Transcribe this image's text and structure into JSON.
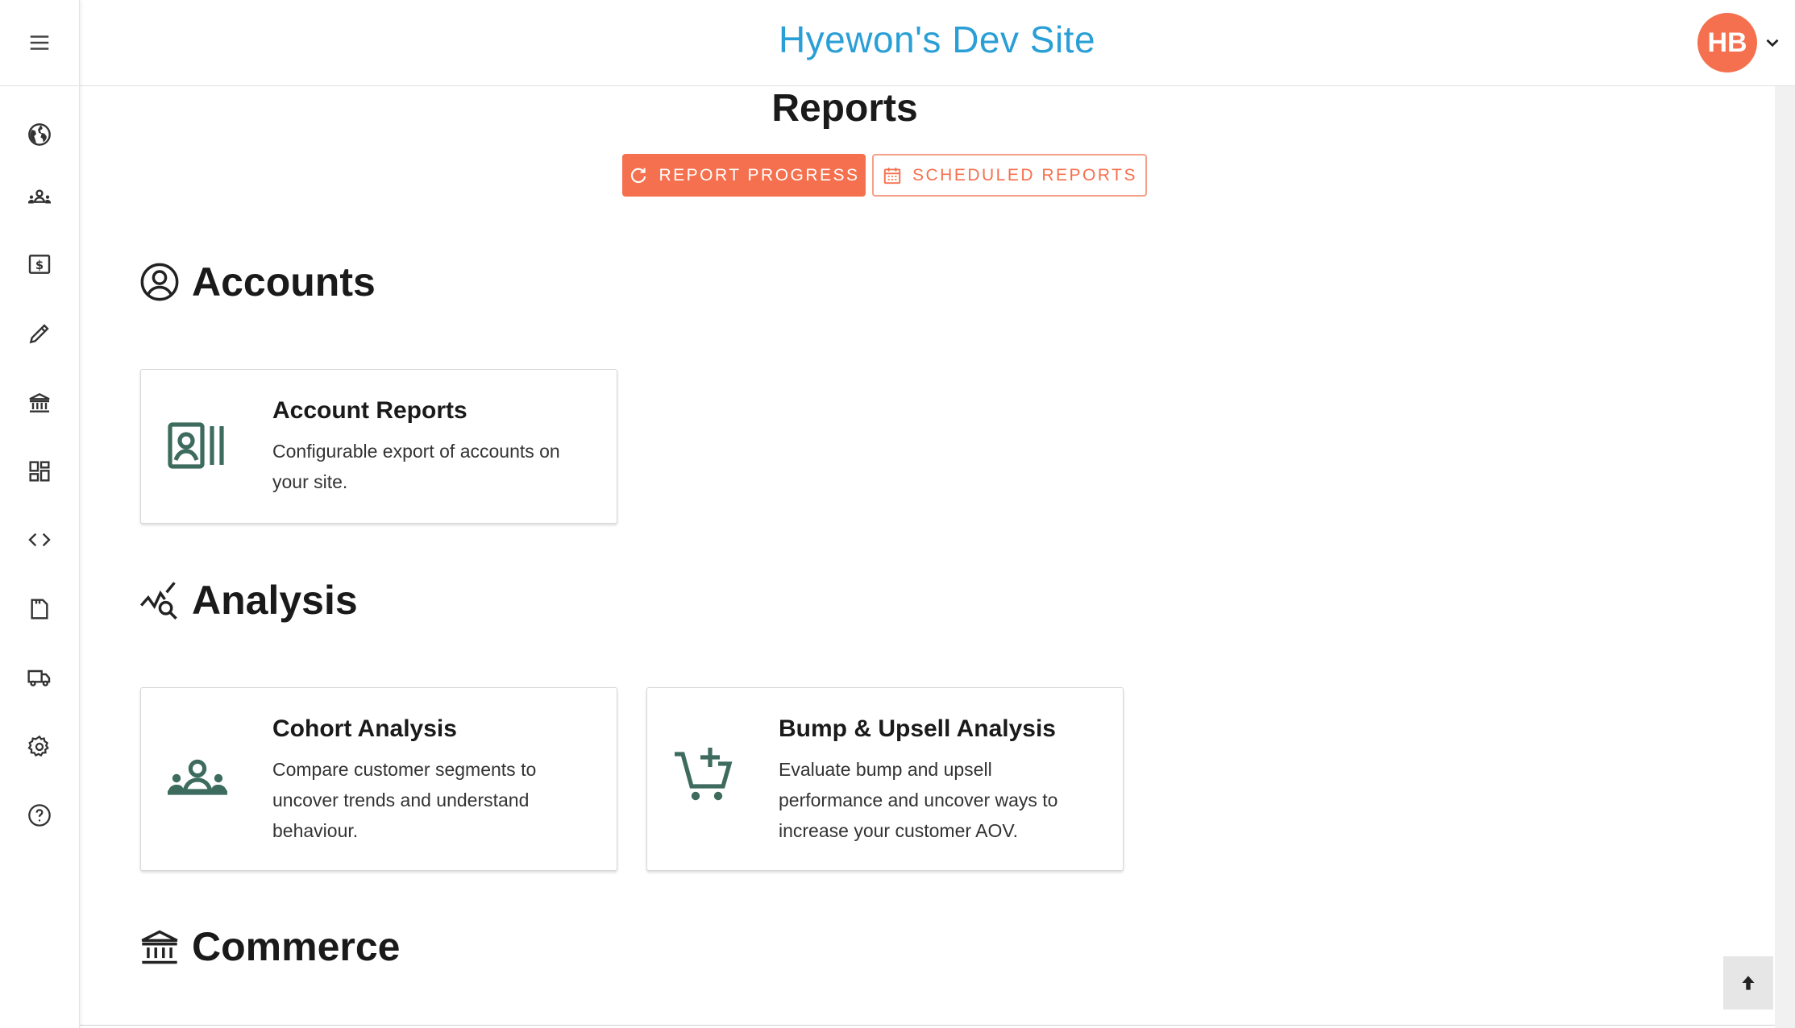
{
  "header": {
    "site_title": "Hyewon's Dev Site",
    "avatar_initials": "HB"
  },
  "sidebar": {
    "items": [
      {
        "icon": "globe-icon"
      },
      {
        "icon": "group-icon"
      },
      {
        "icon": "dollar-icon"
      },
      {
        "icon": "pencil-icon"
      },
      {
        "icon": "bank-icon"
      },
      {
        "icon": "dashboard-icon"
      },
      {
        "icon": "code-icon"
      },
      {
        "icon": "document-icon"
      },
      {
        "icon": "truck-icon"
      },
      {
        "icon": "gear-icon"
      },
      {
        "icon": "help-icon"
      }
    ]
  },
  "main": {
    "page_title": "Reports",
    "buttons": {
      "report_progress": "Report Progress",
      "scheduled_reports": "Scheduled Reports"
    },
    "sections": {
      "accounts": {
        "title": "Accounts",
        "cards": [
          {
            "title": "Account Reports",
            "description": "Configurable export of accounts on your site."
          }
        ]
      },
      "analysis": {
        "title": "Analysis",
        "cards": [
          {
            "title": "Cohort Analysis",
            "description": "Compare customer segments to uncover trends and understand behaviour."
          },
          {
            "title": "Bump & Upsell Analysis",
            "description": "Evaluate bump and upsell performance and uncover ways to increase your customer AOV."
          }
        ]
      },
      "commerce": {
        "title": "Commerce"
      }
    }
  },
  "colors": {
    "accent": "#f5704f",
    "title_blue": "#2a9fd6",
    "card_icon": "#3d6b5e"
  }
}
